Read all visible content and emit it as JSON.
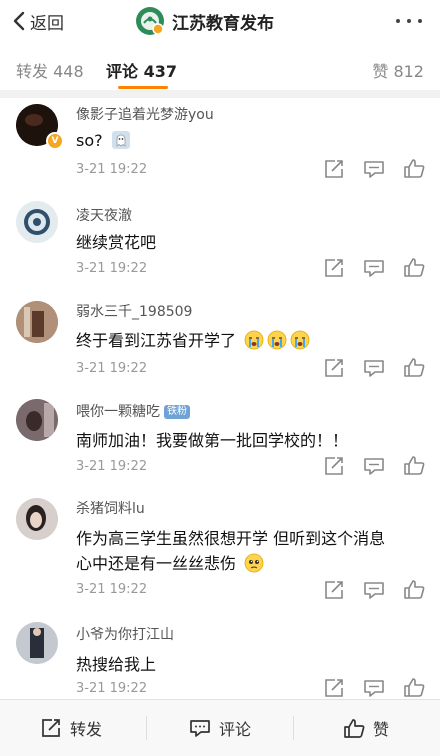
{
  "nav": {
    "back_label": "返回",
    "account_name": "江苏教育发布"
  },
  "tabs": {
    "repost": "转发 448",
    "comment": "评论 437",
    "like": "赞 812"
  },
  "comments": [
    {
      "user": "像影子追着光梦游you",
      "text": "so?",
      "time": "3-21 19:22"
    },
    {
      "user": "凌天夜澈",
      "text": "继续赏花吧",
      "time": "3-21 19:22"
    },
    {
      "user": "弱水三千_198509",
      "text": "终于看到江苏省开学了",
      "time": "3-21 19:22"
    },
    {
      "user": "喂你一颗糖吃",
      "badge": "铁粉",
      "text": "南师加油！我要做第一批回学校的！！",
      "time": "3-21 19:22"
    },
    {
      "user": "杀猪饲料lu",
      "text_line1": "作为高三学生虽然很想开学 但听到这个消息",
      "text_line2": "心中还是有一丝丝悲伤",
      "time": "3-21 19:22"
    },
    {
      "user": "小爷为你打江山",
      "text": "热搜给我上",
      "time": "3-21 19:22"
    }
  ],
  "bottom": {
    "repost": "转发",
    "comment": "评论",
    "like": "赞"
  },
  "icons": [
    "chevron-left-icon",
    "more-dots-icon",
    "share-icon",
    "comment-icon",
    "thumbs-up-icon"
  ],
  "colors": {
    "accent": "#ff8200",
    "vbadge": "#f5a623"
  }
}
